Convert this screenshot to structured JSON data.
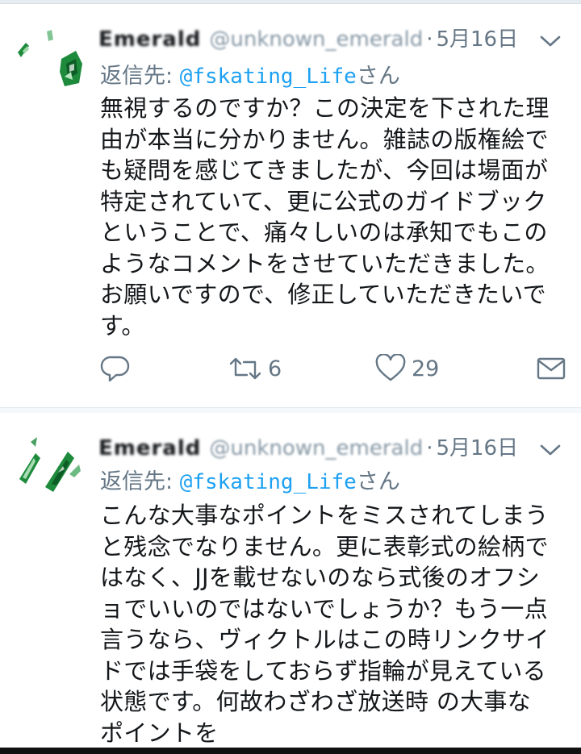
{
  "tweets": [
    {
      "display_name": "Emerald",
      "handle": "@unknown_emerald",
      "separator": "·",
      "date": "5月16日",
      "reply_to_prefix": "返信先: ",
      "reply_to_handle": "@fskating_Life",
      "reply_to_suffix": "さん",
      "lines": [
        "無視するのですか？この決定を下された理",
        "由が本当に分かりません。雑誌の版権絵で",
        "も疑問を感じてきましたが、今回は場面が",
        "特定されていて、更に公式のガイドブック",
        "ということで、痛々しいのは承知でもこの",
        "ようなコメントをさせていただきました。",
        "お願いですので、修正していただきたいで",
        "す。"
      ],
      "retweet_count": "6",
      "like_count": "29"
    },
    {
      "display_name": "Emerald",
      "handle": "@unknown_emerald",
      "separator": "·",
      "date": "5月16日",
      "reply_to_prefix": "返信先: ",
      "reply_to_handle": "@fskating_Life",
      "reply_to_suffix": "さん",
      "lines": [
        "こんな大事なポイントをミスされてしまう",
        "と残念でなりません。更に表彰式の絵柄で",
        "はなく、JJを載せないのなら式後のオフシ",
        "ョでいいのではないでしょうか？もう一点",
        "言うなら、ヴィクトルはこの時リンクサイ",
        "ドでは手袋をしておらず指輪が見えている",
        "状態です。何故わざわざ放送時 の大事な",
        "ポイントを"
      ]
    }
  ],
  "icons": {
    "reply": "reply-icon",
    "retweet": "retweet-icon",
    "like": "heart-icon",
    "dm": "envelope-icon",
    "caret": "chevron-down-icon",
    "avatar": "avatar-image"
  },
  "colors": {
    "link": "#1da1f2",
    "secondary": "#657786",
    "text": "#14171a",
    "avatar_green": "#1e8a3c"
  }
}
